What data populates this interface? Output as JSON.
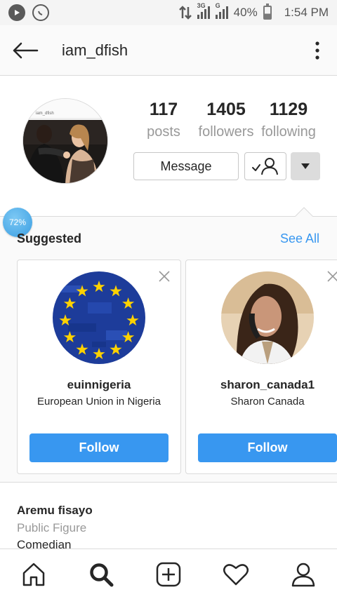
{
  "status_bar": {
    "network_3g": "3G",
    "network_g": "G",
    "battery": "40%",
    "time": "1:54 PM"
  },
  "header": {
    "username": "iam_dfish"
  },
  "profile": {
    "avatar_caption": "iam_dfish",
    "stats": [
      {
        "value": "117",
        "label": "posts"
      },
      {
        "value": "1405",
        "label": "followers"
      },
      {
        "value": "1129",
        "label": "following"
      }
    ],
    "message_label": "Message"
  },
  "progress_badge": "72%",
  "suggested": {
    "title": "Suggested",
    "see_all": "See All",
    "cards": [
      {
        "username": "euinnigeria",
        "full_name": "European Union in Nigeria",
        "follow_label": "Follow"
      },
      {
        "username": "sharon_canada1",
        "full_name": "Sharon Canada",
        "follow_label": "Follow"
      }
    ]
  },
  "bio": {
    "name": "Aremu fisayo",
    "category": "Public Figure",
    "line": "Comedian"
  },
  "colors": {
    "accent": "#3897f0",
    "text": "#262626",
    "muted": "#999999"
  },
  "icons": [
    "back-arrow-icon",
    "more-vertical-icon",
    "follow-check-icon",
    "caret-down-icon",
    "close-icon",
    "home-icon",
    "search-icon",
    "add-post-icon",
    "heart-icon",
    "profile-icon"
  ]
}
